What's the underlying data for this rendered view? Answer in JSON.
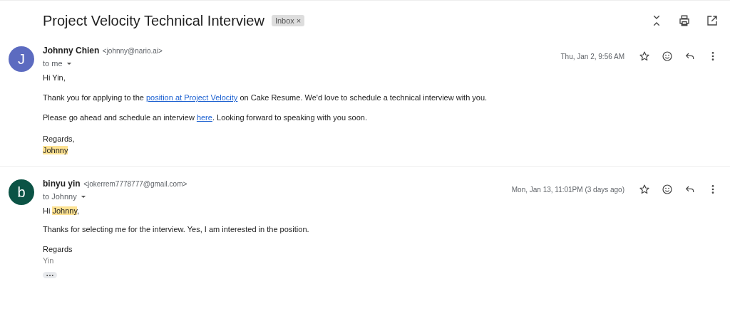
{
  "subject": "Project Velocity Technical Interview",
  "label": {
    "text": "Inbox",
    "close": "×"
  },
  "messages": [
    {
      "avatar": "J",
      "color": "#5c6bc0",
      "sender": "Johnny Chien",
      "email": "<johnny@nario.ai>",
      "to": "to me",
      "date": "Thu, Jan 2, 9:56 AM",
      "collapsed_trail": false,
      "paragraphs": [
        [
          {
            "kind": "text",
            "text": "Hi Yin,"
          }
        ],
        [
          {
            "kind": "text",
            "text": "Thank you for applying to the "
          },
          {
            "kind": "link",
            "text": "position at Project Velocity"
          },
          {
            "kind": "text",
            "text": " on Cake Resume. We'd love to schedule a technical interview with you."
          }
        ],
        [
          {
            "kind": "text",
            "text": "Please go ahead and schedule an interview "
          },
          {
            "kind": "link",
            "text": "here"
          },
          {
            "kind": "text",
            "text": ". Looking forward to speaking with you soon."
          }
        ]
      ],
      "signature": [
        [
          {
            "kind": "text",
            "text": "Regards,"
          }
        ],
        [
          {
            "kind": "highlight",
            "text": "Johnny"
          }
        ]
      ]
    },
    {
      "avatar": "b",
      "color": "#0b5345",
      "sender": "binyu yin",
      "email": "<jokerrem7778777@gmail.com>",
      "to": "to Johnny",
      "date": "Mon, Jan 13, 11:01PM (3 days ago)",
      "collapsed_trail": true,
      "paragraphs": [
        [
          {
            "kind": "text",
            "text": "Hi "
          },
          {
            "kind": "highlight",
            "text": "Johnny"
          },
          {
            "kind": "text",
            "text": ","
          }
        ],
        [
          {
            "kind": "text",
            "text": "Thanks for selecting me for the interview. Yes, I am interested in the position."
          }
        ]
      ],
      "signature": [
        [
          {
            "kind": "text",
            "text": "Regards"
          }
        ],
        [
          {
            "kind": "muted",
            "text": "Yin"
          }
        ]
      ]
    }
  ]
}
